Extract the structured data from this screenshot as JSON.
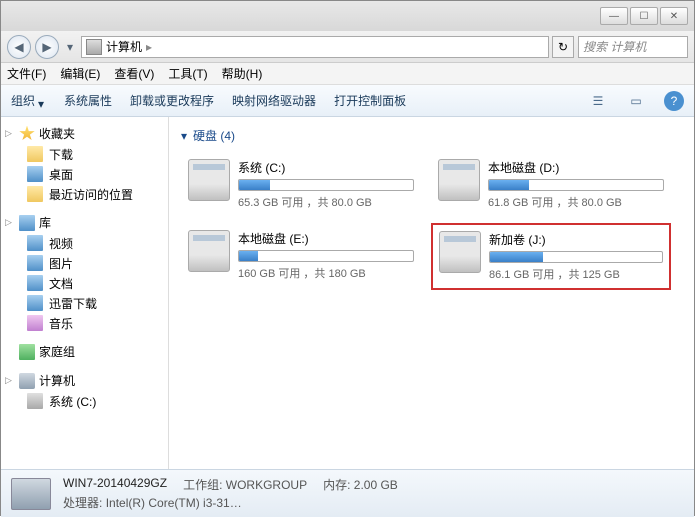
{
  "window": {
    "min": "—",
    "max": "☐",
    "close": "✕"
  },
  "nav": {
    "back": "◀",
    "fwd": "▶",
    "dd": "▾",
    "location": "计算机",
    "sep": "▸",
    "refresh": "↻"
  },
  "search": {
    "placeholder": "搜索 计算机"
  },
  "menu": {
    "file": "文件(F)",
    "edit": "编辑(E)",
    "view": "查看(V)",
    "tools": "工具(T)",
    "help": "帮助(H)"
  },
  "toolbar": {
    "org": "组织",
    "chev": "▾",
    "sysprops": "系统属性",
    "uninstall": "卸载或更改程序",
    "mapdrive": "映射网络驱动器",
    "ctrlpanel": "打开控制面板",
    "help": "?"
  },
  "sidebar": {
    "fav": {
      "label": "收藏夹",
      "items": [
        {
          "label": "下载"
        },
        {
          "label": "桌面"
        },
        {
          "label": "最近访问的位置"
        }
      ]
    },
    "lib": {
      "label": "库",
      "items": [
        {
          "label": "视频"
        },
        {
          "label": "图片"
        },
        {
          "label": "文档"
        },
        {
          "label": "迅雷下载"
        },
        {
          "label": "音乐"
        }
      ]
    },
    "home": {
      "label": "家庭组"
    },
    "comp": {
      "label": "计算机",
      "items": [
        {
          "label": "系统 (C:)"
        }
      ]
    }
  },
  "content": {
    "section": "硬盘 (4)",
    "tri": "▾",
    "drives": [
      {
        "name": "系统 (C:)",
        "free": "65.3 GB 可用 ，共 80.0 GB",
        "fill": 18,
        "hl": false
      },
      {
        "name": "本地磁盘 (D:)",
        "free": "61.8 GB 可用 ，共 80.0 GB",
        "fill": 23,
        "hl": false
      },
      {
        "name": "本地磁盘 (E:)",
        "free": "160 GB 可用 ，共 180 GB",
        "fill": 11,
        "hl": false
      },
      {
        "name": "新加卷 (J:)",
        "free": "86.1 GB 可用 ，共 125 GB",
        "fill": 31,
        "hl": true
      }
    ]
  },
  "status": {
    "name": "WIN7-20140429GZ",
    "wg_label": "工作组:",
    "wg": "WORKGROUP",
    "mem_label": "内存:",
    "mem": "2.00 GB",
    "cpu_label": "处理器:",
    "cpu": "Intel(R) Core(TM) i3-31…"
  }
}
